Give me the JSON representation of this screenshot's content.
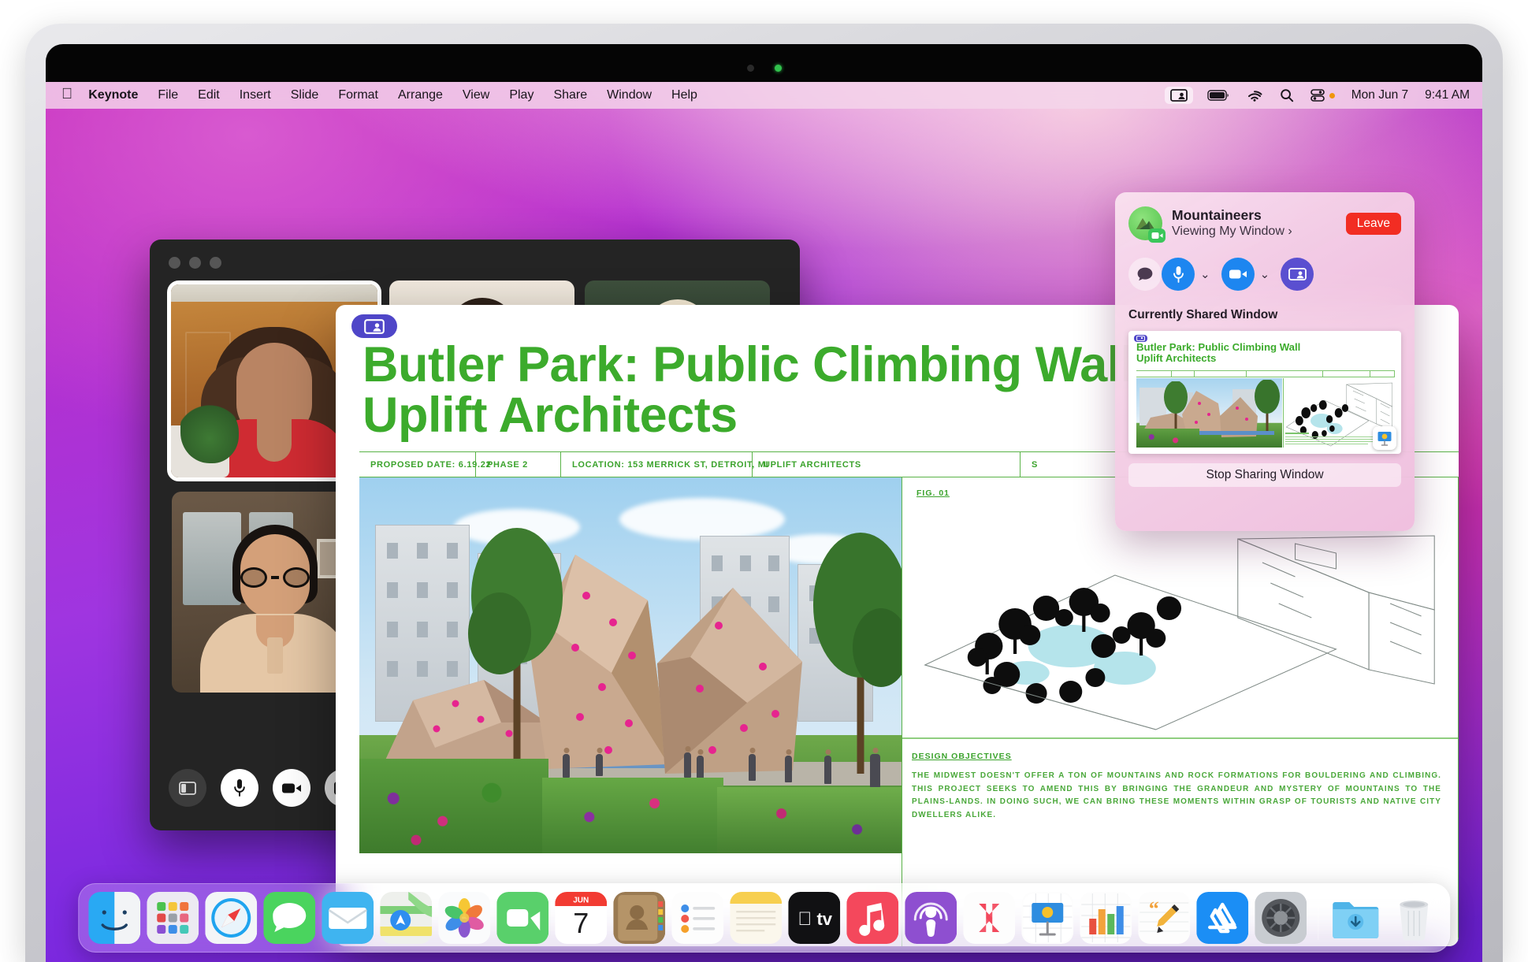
{
  "menubar": {
    "apple_logo": "apple-logo",
    "items": [
      {
        "label": "Keynote",
        "bold": true
      },
      {
        "label": "File"
      },
      {
        "label": "Edit"
      },
      {
        "label": "Insert"
      },
      {
        "label": "Slide"
      },
      {
        "label": "Format"
      },
      {
        "label": "Arrange"
      },
      {
        "label": "View"
      },
      {
        "label": "Play"
      },
      {
        "label": "Share"
      },
      {
        "label": "Window"
      },
      {
        "label": "Help"
      }
    ],
    "status": {
      "screen_share_icon": "screen-share-icon",
      "battery_icon": "battery-icon",
      "wifi_icon": "wifi-icon",
      "search_icon": "search-icon",
      "control_center_icon": "control-center-icon",
      "control_center_dot_color": "#f0960b",
      "date": "Mon Jun 7",
      "time": "9:41 AM"
    }
  },
  "facetime": {
    "window_name": "FaceTime",
    "controls": [
      {
        "name": "sidebar-toggle",
        "icon": "sidebar-icon",
        "style": "dark"
      },
      {
        "name": "microphone",
        "icon": "microphone-icon",
        "style": "white"
      },
      {
        "name": "camera",
        "icon": "video-camera-icon",
        "style": "white"
      },
      {
        "name": "screen-share",
        "icon": "screen-share-icon",
        "style": "grayish"
      }
    ]
  },
  "keynote": {
    "badge_icon": "screen-share-badge-icon",
    "slide_title_line1": "Butler Park: Public Climbing Wall",
    "slide_title_line2": "Uplift Architects",
    "accent_color": "#3cab2c",
    "meta_bar": [
      "PROPOSED DATE: 6.19.22",
      "PHASE 2",
      "LOCATION: 153 MERRICK ST, DETROIT, MI",
      "UPLIFT ARCHITECTS",
      "S",
      ""
    ],
    "fig_label": "FIG. 01",
    "design_objectives_heading": "DESIGN OBJECTIVES",
    "design_objectives_body": "THE MIDWEST DOESN'T OFFER A TON OF MOUNTAINS AND ROCK FORMATIONS FOR BOULDERING AND CLIMBING. THIS PROJECT SEEKS TO AMEND THIS BY BRINGING THE GRANDEUR AND MYSTERY OF MOUNTAINS TO THE PLAINS-LANDS. IN DOING SUCH, WE CAN BRING THESE MOMENTS WITHIN GRASP OF TOURISTS AND NATIVE CITY DWELLERS ALIKE."
  },
  "shareplay": {
    "group_name": "Mountaineers",
    "status_line": "Viewing My Window ›",
    "leave_label": "Leave",
    "avatar_icon": "mountain-avatar-icon",
    "avatar_badge_icon": "video-camera-icon",
    "controls": [
      {
        "name": "messages",
        "icon": "chat-bubble-icon",
        "style": "ghost",
        "chevron": false
      },
      {
        "name": "microphone",
        "icon": "microphone-icon",
        "style": "blue",
        "chevron": true
      },
      {
        "name": "camera",
        "icon": "video-camera-icon",
        "style": "blue",
        "chevron": true
      },
      {
        "name": "screen-share",
        "icon": "screen-share-icon",
        "style": "indigo",
        "chevron": false
      }
    ],
    "section_title": "Currently Shared Window",
    "thumbnail_title_line1": "Butler Park: Public Climbing Wall",
    "thumbnail_title_line2": "Uplift Architects",
    "thumbnail_app_icon": "keynote-icon",
    "stop_sharing_label": "Stop Sharing Window",
    "leave_color": "#f22d23"
  },
  "dock": {
    "items": [
      {
        "name": "finder",
        "label": "Finder",
        "running": true
      },
      {
        "name": "launchpad",
        "label": "Launchpad",
        "running": false
      },
      {
        "name": "safari",
        "label": "Safari",
        "running": false
      },
      {
        "name": "messages",
        "label": "Messages",
        "running": false
      },
      {
        "name": "mail",
        "label": "Mail",
        "running": false
      },
      {
        "name": "maps",
        "label": "Maps",
        "running": false
      },
      {
        "name": "photos",
        "label": "Photos",
        "running": false
      },
      {
        "name": "facetime",
        "label": "FaceTime",
        "running": true
      },
      {
        "name": "calendar",
        "label": "Calendar",
        "running": false,
        "month": "JUN",
        "day": "7"
      },
      {
        "name": "contacts",
        "label": "Contacts",
        "running": false
      },
      {
        "name": "reminders",
        "label": "Reminders",
        "running": false
      },
      {
        "name": "notes",
        "label": "Notes",
        "running": false
      },
      {
        "name": "apple-tv",
        "label": "TV",
        "running": false
      },
      {
        "name": "music",
        "label": "Music",
        "running": false
      },
      {
        "name": "podcasts",
        "label": "Podcasts",
        "running": false
      },
      {
        "name": "news",
        "label": "News",
        "running": false
      },
      {
        "name": "keynote",
        "label": "Keynote",
        "running": true
      },
      {
        "name": "numbers",
        "label": "Numbers",
        "running": false
      },
      {
        "name": "pages",
        "label": "Pages",
        "running": false
      },
      {
        "name": "app-store",
        "label": "App Store",
        "running": false
      },
      {
        "name": "system-preferences",
        "label": "System Preferences",
        "running": false
      }
    ],
    "downloads_label": "Downloads",
    "trash_label": "Trash"
  }
}
